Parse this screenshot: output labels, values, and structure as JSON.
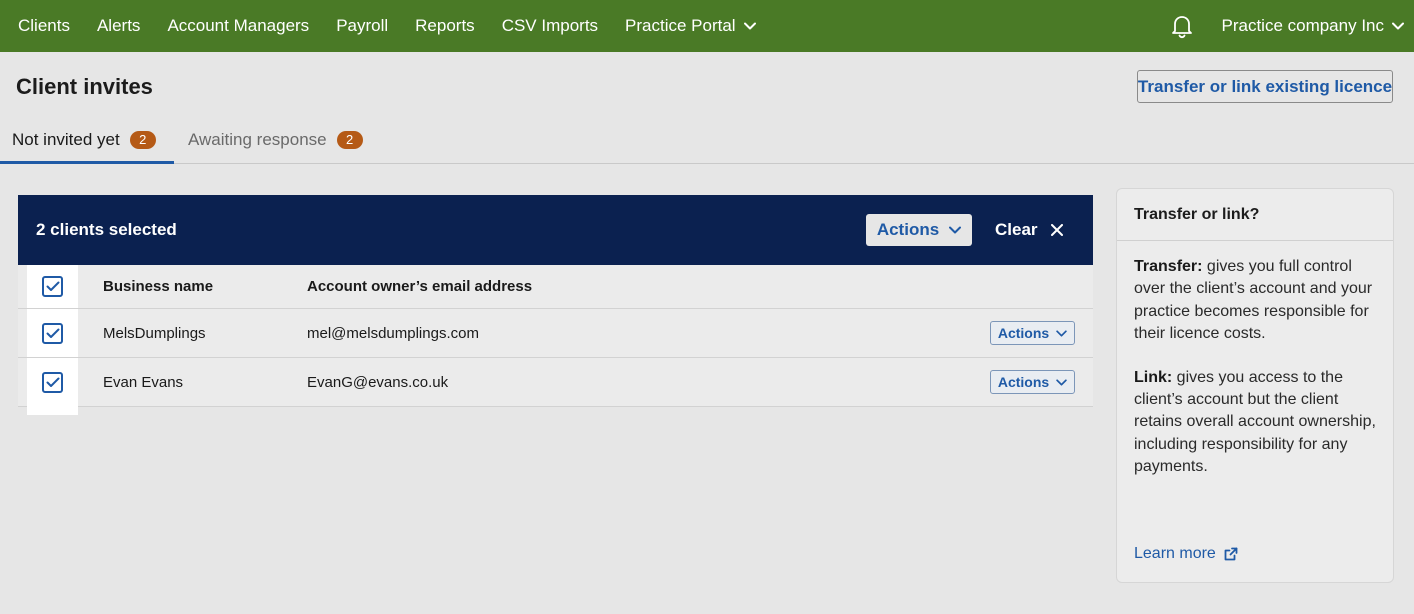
{
  "topnav": {
    "links": [
      {
        "label": "Clients"
      },
      {
        "label": "Alerts"
      },
      {
        "label": "Account Managers"
      },
      {
        "label": "Payroll"
      },
      {
        "label": "Reports"
      },
      {
        "label": "CSV Imports"
      },
      {
        "label": "Practice Portal"
      }
    ],
    "company": "Practice company Inc",
    "icons": {
      "notifications": "bell-icon",
      "dropdown": "chevron-down-icon"
    }
  },
  "page": {
    "title": "Client invites",
    "transfer_button": "Transfer or link existing licence"
  },
  "tabs": [
    {
      "label": "Not invited yet",
      "count": "2",
      "active": true
    },
    {
      "label": "Awaiting response",
      "count": "2",
      "active": false
    }
  ],
  "selection_bar": {
    "count_text": "2 clients selected",
    "actions_label": "Actions",
    "clear_label": "Clear"
  },
  "table": {
    "headers": {
      "name": "Business name",
      "email": "Account owner’s email address"
    },
    "rows": [
      {
        "name": "MelsDumplings",
        "email": "mel@melsdumplings.com",
        "actions": "Actions",
        "checked": true
      },
      {
        "name": "Evan Evans",
        "email": "EvanG@evans.co.uk",
        "actions": "Actions",
        "checked": true
      }
    ]
  },
  "side_card": {
    "title": "Transfer or link?",
    "transfer_term": "Transfer:",
    "transfer_text": " gives you full control over the client’s account and your practice becomes responsible for their licence costs.",
    "link_term": "Link:",
    "link_text": " gives you access to the client’s account but the client retains overall account ownership, including responsibility for any payments.",
    "learn_more": "Learn more"
  },
  "colors": {
    "nav_bg": "#4a7a26",
    "selection_bar_bg": "#0b2150",
    "accent_blue": "#1f5aa6",
    "badge": "#b55a16",
    "page_bg": "#e6e6e6"
  }
}
